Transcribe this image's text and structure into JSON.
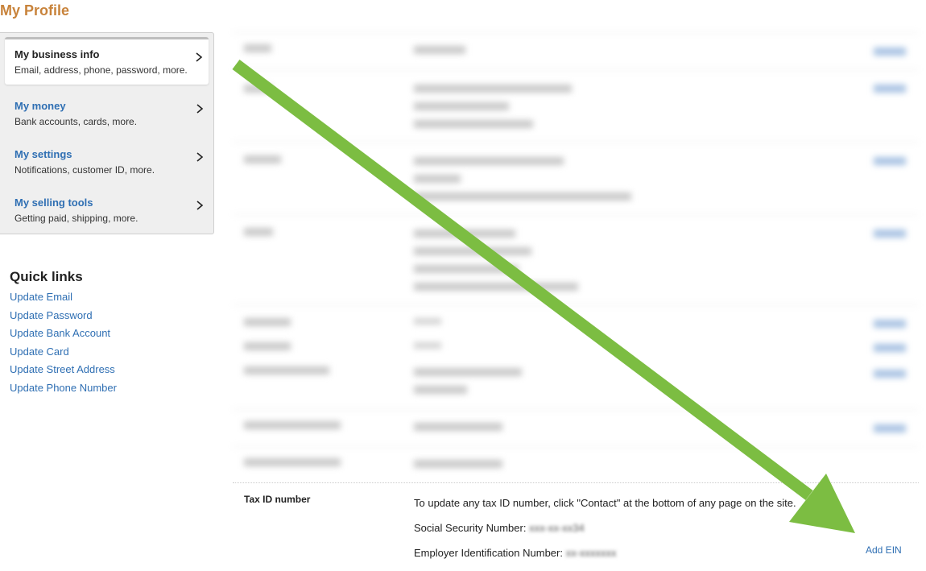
{
  "page": {
    "title": "My Profile"
  },
  "nav": {
    "items": [
      {
        "label": "My business info",
        "sub": "Email, address, phone, password, more."
      },
      {
        "label": "My money",
        "sub": "Bank accounts, cards, more."
      },
      {
        "label": "My settings",
        "sub": "Notifications, customer ID, more."
      },
      {
        "label": "My selling tools",
        "sub": "Getting paid, shipping, more."
      }
    ]
  },
  "quick_links": {
    "title": "Quick links",
    "items": [
      "Update Email",
      "Update Password",
      "Update Bank Account",
      "Update Card",
      "Update Street Address",
      "Update Phone Number"
    ]
  },
  "tax": {
    "label": "Tax ID number",
    "note": "To update any tax ID number, click \"Contact\" at the bottom of any page on the site.",
    "ssn_label": "Social Security Number:",
    "ssn_value": "xxx-xx-xx34",
    "ein_label": "Employer Identification Number:",
    "ein_value": "xx-xxxxxxx",
    "add_ein": "Add EIN"
  },
  "colors": {
    "title": "#c8833b",
    "link": "#2f6fb3",
    "annotation_arrow": "#7cbd42"
  }
}
